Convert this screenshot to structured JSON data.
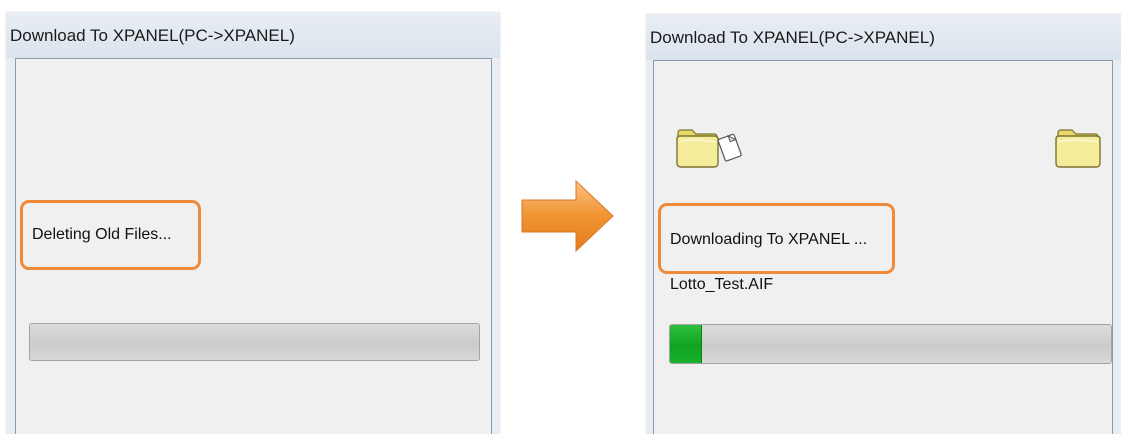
{
  "dialogs": {
    "left": {
      "title": "Download To XPANEL(PC->XPANEL)",
      "status": "Deleting Old Files...",
      "progress_percent": 0
    },
    "right": {
      "title": "Download To XPANEL(PC->XPANEL)",
      "status": "Downloading To XPANEL ...",
      "filename": "Lotto_Test.AIF",
      "progress_percent": 7,
      "source_icon": "folder-with-file-icon",
      "target_icon": "folder-icon"
    }
  },
  "annotations": {
    "highlight_color": "#ee8a3a",
    "arrow_icon": "right-arrow-icon",
    "arrow_color": "#f0922e"
  }
}
